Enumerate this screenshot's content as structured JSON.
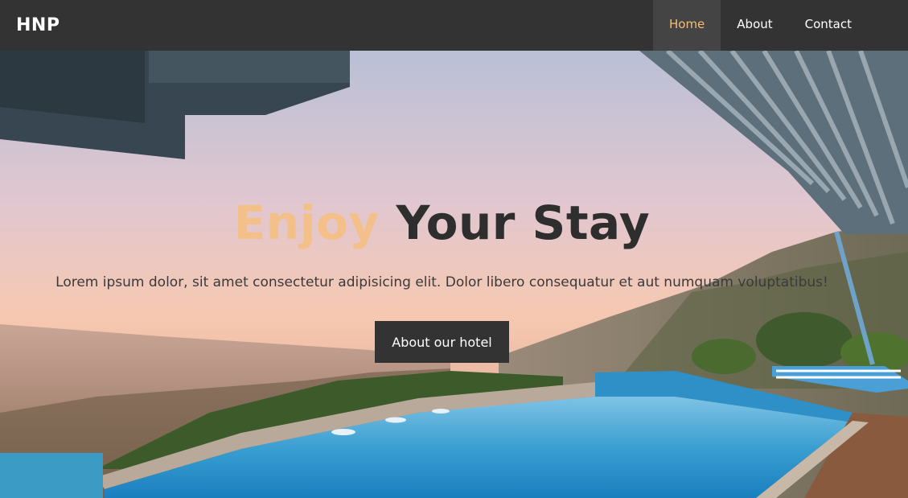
{
  "brand": {
    "logo": "HNP",
    "accent_color": "#f3bd79",
    "dark_color": "#333333"
  },
  "nav": {
    "items": [
      {
        "label": "Home",
        "active": true
      },
      {
        "label": "About",
        "active": false
      },
      {
        "label": "Contact",
        "active": false
      }
    ]
  },
  "hero": {
    "title_accent": "Enjoy",
    "title_rest": "Your Stay",
    "subtitle": "Lorem ipsum dolor, sit amet consectetur adipisicing elit. Dolor libero consequatur et aut numquam voluptatibus!",
    "button_label": "About our hotel",
    "background_image": "infinity pool overlooking coastal city at sunset"
  }
}
